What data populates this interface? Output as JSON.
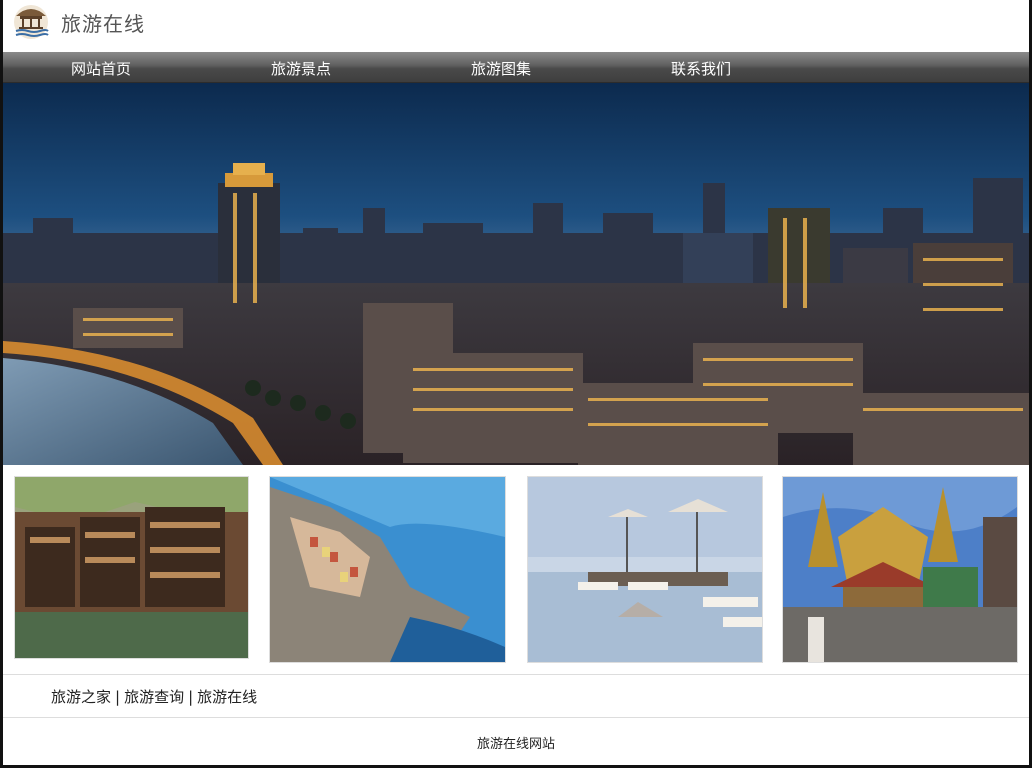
{
  "header": {
    "title": "旅游在线",
    "logo_icon": "pavilion-logo-icon"
  },
  "nav": {
    "items": [
      {
        "label": "网站首页"
      },
      {
        "label": "旅游景点"
      },
      {
        "label": "旅游图集"
      },
      {
        "label": "联系我们"
      }
    ]
  },
  "links": {
    "items": [
      {
        "label": "旅游之家"
      },
      {
        "label": "旅游查询"
      },
      {
        "label": "旅游在线"
      }
    ],
    "separator": "|"
  },
  "footer": {
    "text": "旅游在线网站"
  },
  "colors": {
    "nav_bg": "#5f5f5f",
    "title": "#555555"
  }
}
